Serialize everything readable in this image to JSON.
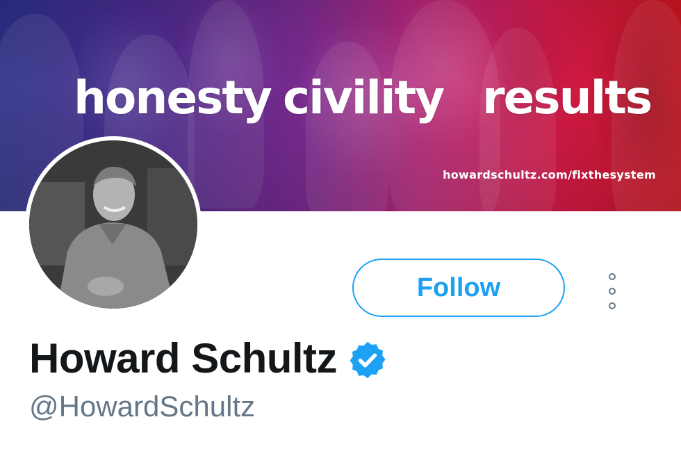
{
  "banner": {
    "words": [
      "honesty",
      "civility",
      "results"
    ],
    "url": "howardschultz.com/fixthesystem"
  },
  "profile": {
    "display_name": "Howard Schultz",
    "handle": "@HowardSchultz",
    "verified": true
  },
  "actions": {
    "follow_label": "Follow",
    "more_icon": "more-vertical-icon"
  },
  "colors": {
    "accent": "#1da1f2",
    "name": "#14171a",
    "secondary": "#657786"
  }
}
